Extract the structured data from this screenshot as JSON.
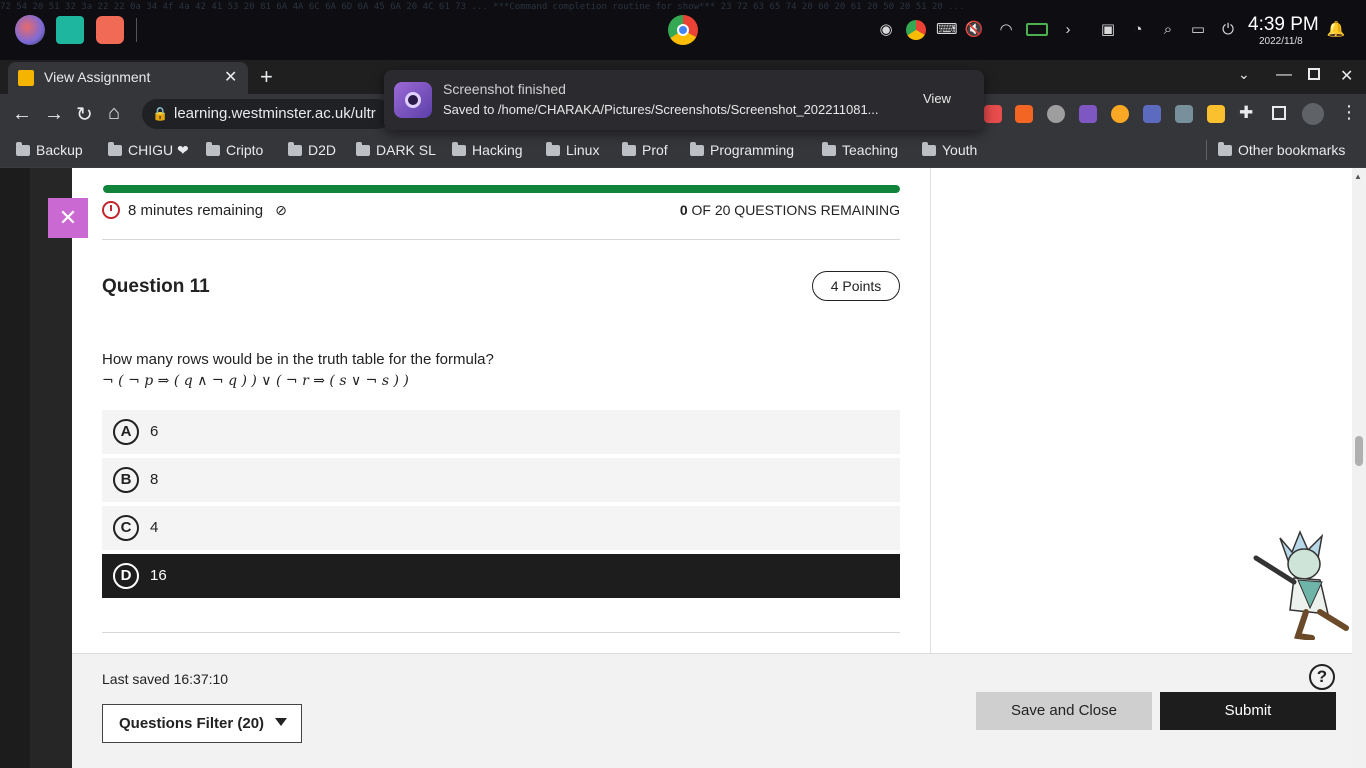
{
  "os": {
    "clock": "4:39 PM",
    "date": "2022/11/8",
    "terminal_text": "72 54 20 51 32 3a 22 22 0a 34 4f 4a 42 41 53 20 81 6A 4A 6C 6A 6D 6A 45 6A 20 4C 61 73 ... ***Command completion routine for show*** 23 72 63 65 74 20 60 20 61 20 50 20 51 20 ..."
  },
  "browser": {
    "tab_title": "View Assignment",
    "url": "learning.westminster.ac.uk/ultr",
    "bookmarks": [
      "Backup",
      "CHIGU ❤",
      "Cripto",
      "D2D",
      "DARK SL",
      "Hacking",
      "Linux",
      "Prof",
      "Programming",
      "Teaching",
      "Youth"
    ],
    "other_bookmarks": "Other bookmarks"
  },
  "notification": {
    "title": "Screenshot finished",
    "body": "Saved to /home/CHARAKA/Pictures/Screenshots/Screenshot_202211081...",
    "action": "View"
  },
  "assessment": {
    "progress_fraction": 1.0,
    "timer": "8 minutes remaining",
    "remaining_count": "0",
    "remaining_text": "OF 20 QUESTIONS REMAINING",
    "question_title": "Question 11",
    "points": "4 Points",
    "question_text": "How many rows would be in the truth table for the formula?",
    "formula": "¬ ( ¬ p ⇒ ( q ∧ ¬ q ) ) ∨ ( ¬ r ⇒ ( s ∨ ¬ s ) )",
    "answers": [
      {
        "letter": "A",
        "text": "6",
        "selected": false
      },
      {
        "letter": "B",
        "text": "8",
        "selected": false
      },
      {
        "letter": "C",
        "text": "4",
        "selected": false
      },
      {
        "letter": "D",
        "text": "16",
        "selected": true
      }
    ],
    "last_saved": "Last saved 16:37:10",
    "filter_label": "Questions Filter (20)",
    "save_close_label": "Save and Close",
    "submit_label": "Submit",
    "help_symbol": "?"
  },
  "colors": {
    "progress": "#10843b",
    "timer_icon": "#c1272d",
    "close_panel": "#c969d1"
  }
}
